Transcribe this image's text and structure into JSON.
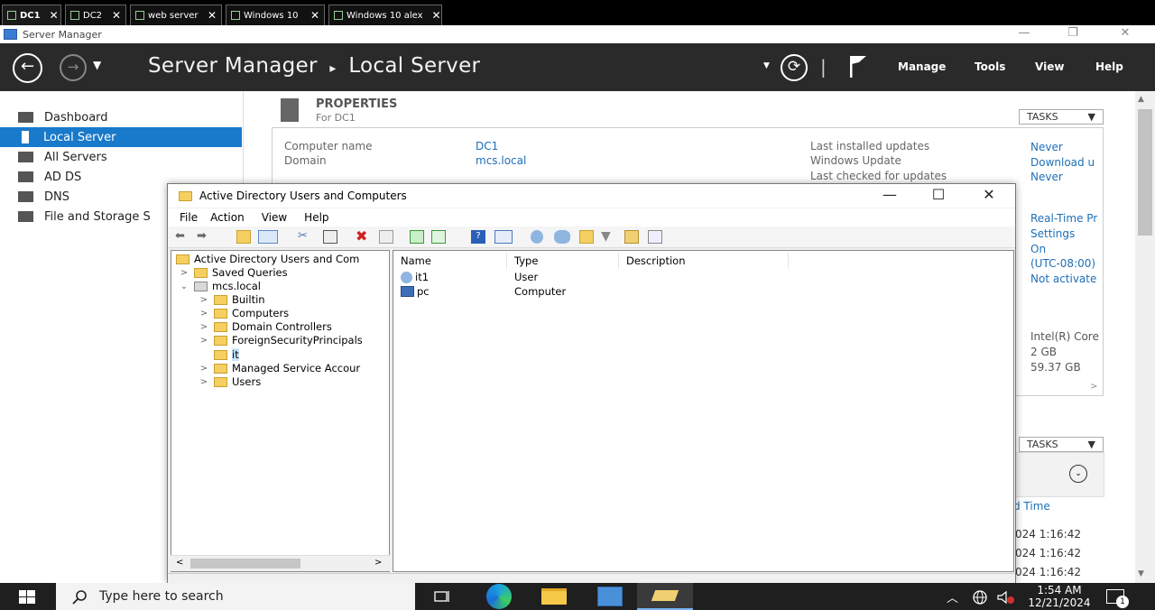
{
  "vm_tabs": [
    {
      "label": "DC1",
      "active": true
    },
    {
      "label": "DC2",
      "active": false
    },
    {
      "label": "web server",
      "active": false
    },
    {
      "label": "Windows 10",
      "active": false
    },
    {
      "label": "Windows 10 alex",
      "active": false
    }
  ],
  "tab_close": "✕",
  "window": {
    "title": "Server Manager",
    "minimize": "—",
    "restore": "❐",
    "close": "✕"
  },
  "header": {
    "breadcrumb_root": "Server Manager",
    "breadcrumb_sep": "▸",
    "breadcrumb_page": "Local Server",
    "refresh_separator": "|",
    "menu": [
      "Manage",
      "Tools",
      "View",
      "Help"
    ]
  },
  "sidebar": {
    "items": [
      {
        "label": "Dashboard",
        "icon": "dashboard-icon",
        "selected": false
      },
      {
        "label": "Local Server",
        "icon": "local-server-icon",
        "selected": true
      },
      {
        "label": "All Servers",
        "icon": "all-servers-icon",
        "selected": false
      },
      {
        "label": "AD DS",
        "icon": "ad-ds-icon",
        "selected": false
      },
      {
        "label": "DNS",
        "icon": "dns-icon",
        "selected": false
      },
      {
        "label": "File and Storage S",
        "icon": "file-storage-icon",
        "selected": false
      }
    ]
  },
  "properties": {
    "title": "PROPERTIES",
    "subtitle": "For DC1",
    "tasks": "TASKS",
    "left": [
      {
        "label": "Computer name",
        "value": "DC1"
      },
      {
        "label": "Domain",
        "value": "mcs.local"
      }
    ],
    "right_labels": [
      "Last installed updates",
      "Windows Update",
      "Last checked for updates"
    ],
    "right_values": [
      "Never",
      "Download u",
      "Never",
      "Real-Time Pr",
      "Settings",
      "On",
      "(UTC-08:00)",
      "Not activate",
      "Intel(R) Core",
      "2 GB",
      "59.37 GB"
    ],
    "scroll_arrow": ">"
  },
  "events": {
    "tasks": "TASKS",
    "column": "d Time",
    "rows": [
      "024 1:16:42",
      "024 1:16:42",
      "024 1:16:42"
    ]
  },
  "aduc": {
    "title": "Active Directory Users and Computers",
    "minimize": "—",
    "maximize": "☐",
    "close": "✕",
    "menu": [
      "File",
      "Action",
      "View",
      "Help"
    ],
    "tree": {
      "root": "Active Directory Users and Com",
      "saved_queries": "Saved Queries",
      "domain": "mcs.local",
      "children": [
        "Builtin",
        "Computers",
        "Domain Controllers",
        "ForeignSecurityPrincipals",
        "it",
        "Managed Service Accour",
        "Users"
      ]
    },
    "columns": [
      "Name",
      "Type",
      "Description"
    ],
    "rows": [
      {
        "name": "it1",
        "type": "User",
        "description": ""
      },
      {
        "name": "pc",
        "type": "Computer",
        "description": ""
      }
    ]
  },
  "taskbar": {
    "search_placeholder": "Type here to search",
    "time": "1:54 AM",
    "date": "12/21/2024",
    "notification_count": "1"
  },
  "colors": {
    "accent": "#1979ca",
    "header_bg": "#2a2a2a",
    "link": "#1d6fb8"
  }
}
